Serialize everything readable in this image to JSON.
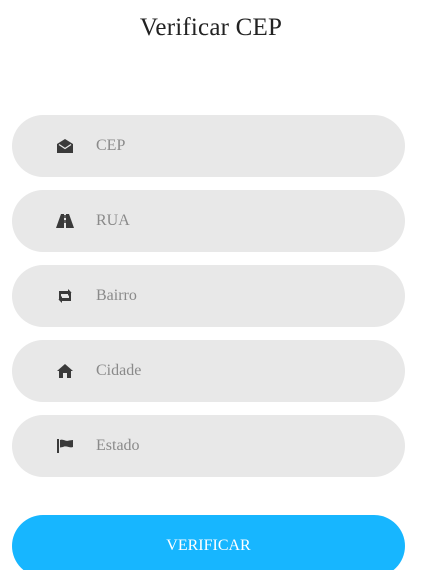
{
  "title": "Verificar CEP",
  "fields": {
    "cep": {
      "placeholder": "CEP",
      "value": "",
      "icon": "envelope-open-icon"
    },
    "rua": {
      "placeholder": "RUA",
      "value": "",
      "icon": "road-icon"
    },
    "bairro": {
      "placeholder": "Bairro",
      "value": "",
      "icon": "retweet-icon"
    },
    "cidade": {
      "placeholder": "Cidade",
      "value": "",
      "icon": "home-icon"
    },
    "estado": {
      "placeholder": "Estado",
      "value": "",
      "icon": "flag-icon"
    }
  },
  "button": {
    "label": "VERIFICAR"
  },
  "colors": {
    "field_bg": "#e8e8e8",
    "button_bg": "#17b6ff",
    "button_text": "#ffffff",
    "icon": "#3a3a3a",
    "placeholder": "#8a8a8a"
  }
}
